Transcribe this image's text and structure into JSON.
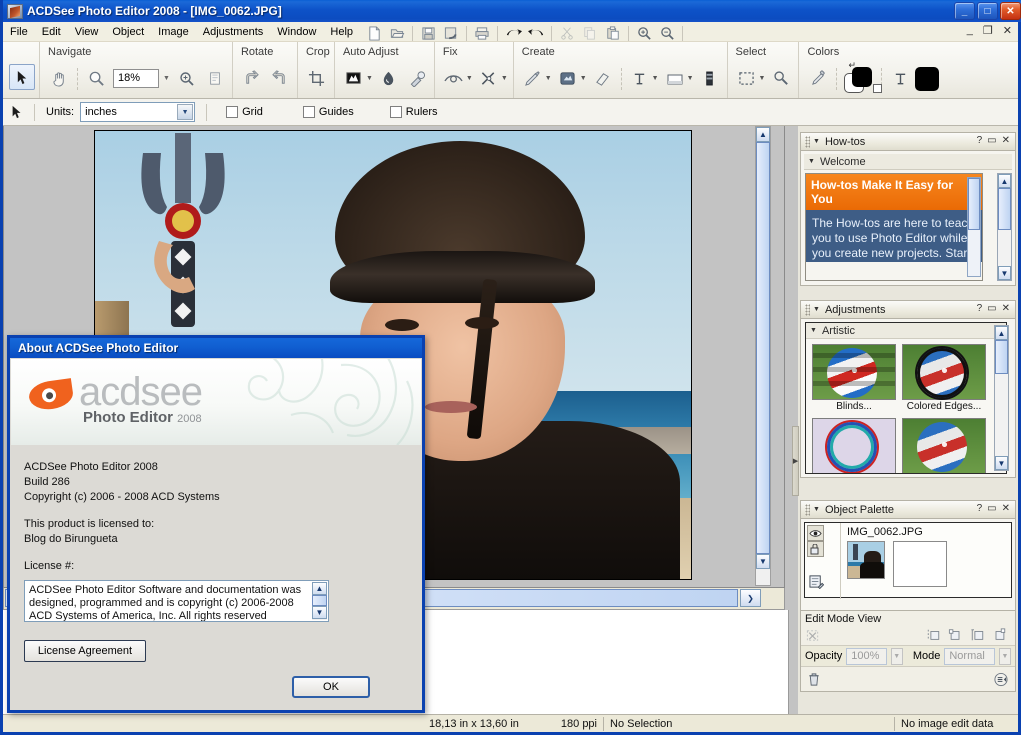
{
  "window": {
    "title": "ACDSee Photo Editor 2008 - [IMG_0062.JPG]",
    "minimize": "_",
    "maximize": "□",
    "close": "✕",
    "mdi_minimize": "_",
    "mdi_restore": "❐",
    "mdi_close": "✕"
  },
  "menu": {
    "items": [
      {
        "label": "File"
      },
      {
        "label": "Edit"
      },
      {
        "label": "View"
      },
      {
        "label": "Object"
      },
      {
        "label": "Image"
      },
      {
        "label": "Adjustments"
      },
      {
        "label": "Window"
      },
      {
        "label": "Help"
      }
    ]
  },
  "standard_toolbar": {
    "icons": [
      "new-icon",
      "open-icon",
      "save-icon",
      "save-as-icon",
      "print-icon",
      "undo-icon",
      "redo-icon",
      "cut-icon",
      "copy-icon",
      "paste-icon",
      "zoom-in-icon",
      "zoom-out-icon"
    ]
  },
  "ribbon": {
    "groups": [
      {
        "title": "Navigate",
        "buttons": [
          "select-tool",
          "pan-tool-icon",
          "zoom-tool-icon",
          "zoom-fit-icon",
          "zoom-actual-icon"
        ]
      },
      {
        "title": "Rotate",
        "buttons": [
          "rotate-right-icon",
          "rotate-left-icon"
        ]
      },
      {
        "title": "Crop",
        "buttons": [
          "crop-icon"
        ]
      },
      {
        "title": "Auto Adjust",
        "buttons": [
          "auto-levels-icon",
          "red-eye-icon",
          "repair-icon"
        ]
      },
      {
        "title": "Fix",
        "buttons": [
          "red-eye-fix-icon",
          "blemish-remover-icon"
        ]
      },
      {
        "title": "Create",
        "buttons": [
          "brush-icon",
          "effects-icon",
          "eraser-icon",
          "text-icon",
          "shape-icon",
          "gradient-icon"
        ]
      },
      {
        "title": "Select",
        "buttons": [
          "marquee-icon",
          "magic-wand-icon"
        ]
      },
      {
        "title": "Colors",
        "buttons": [
          "eyedropper-icon",
          "color-swatches",
          "text-color-icon",
          "fill-color-swatch"
        ]
      }
    ],
    "zoom_value": "18%",
    "zoom_dropdown_icon": "chevron-down-icon"
  },
  "options_bar": {
    "pointer_icon": "arrow-pointer-icon",
    "units_label": "Units:",
    "units_value": "inches",
    "checkboxes": [
      {
        "label": "Grid",
        "checked": false
      },
      {
        "label": "Guides",
        "checked": false
      },
      {
        "label": "Rulers",
        "checked": false
      }
    ]
  },
  "canvas": {
    "zoom": "18%",
    "image_name": "IMG_0062.JPG",
    "scrollbar_right_arrow": "❯",
    "scroll_up_arrow": "▲",
    "scroll_down_arrow": "▼"
  },
  "panels": {
    "howtos": {
      "title": "How-tos",
      "help_btn": "?",
      "maximize_btn": "▭",
      "close_btn": "✕",
      "section": "Welcome",
      "banner": "How-tos Make It Easy for You",
      "body": "The How-tos are here to teach you to use Photo Editor while you create new projects. Start with"
    },
    "adjustments": {
      "title": "Adjustments",
      "help_btn": "?",
      "maximize_btn": "▭",
      "close_btn": "✕",
      "section": "Artistic",
      "items": [
        {
          "label": "Blinds...",
          "thumb": "blinds-thumbnail"
        },
        {
          "label": "Colored Edges...",
          "thumb": "colored-edges-thumbnail"
        },
        {
          "label": "",
          "thumb": "contours-thumbnail"
        },
        {
          "label": "",
          "thumb": "crosshatch-thumbnail"
        }
      ]
    },
    "object_palette": {
      "title": "Object Palette",
      "help_btn": "?",
      "maximize_btn": "▭",
      "close_btn": "✕",
      "layer_name": "IMG_0062.JPG",
      "visibility_icon": "eye-icon",
      "link-icon": "link-layers-icon",
      "properties_icon": "layer-properties-icon",
      "edit_mode_label": "Edit Mode View",
      "opacity_label": "Opacity",
      "opacity_value": "100%",
      "mode_label": "Mode",
      "mode_value": "Normal",
      "delete_icon": "trash-icon",
      "menu_icon": "palette-menu-icon"
    }
  },
  "statusbar": {
    "dimensions": "18,13 in x 13,60 in",
    "resolution": "180 ppi",
    "selection": "No Selection",
    "edit_data": "No image edit data"
  },
  "about_dialog": {
    "title": "About ACDSee Photo Editor",
    "logo_word": "acdsee",
    "logo_sub": "Photo Editor",
    "logo_year": "2008",
    "product": "ACDSee Photo Editor 2008",
    "build": "Build 286",
    "copyright": "Copyright (c) 2006 - 2008 ACD Systems",
    "licensed_to_label": "This product is licensed to:",
    "licensed_to_name": "Blog do Birungueta",
    "license_label": "License #:",
    "license_text_lines": [
      "ACDSee Photo Editor Software and documentation was",
      "designed, programmed and is copyright (c) 2006-2008",
      "ACD Systems of America, Inc. All rights reserved"
    ],
    "license_agreement_button": "License Agreement",
    "ok_button": "OK",
    "scroll_up": "▲",
    "scroll_down": "▼"
  },
  "colors": {
    "titlebar_start": "#0a5fd4",
    "titlebar_end": "#0c4cc0",
    "accent_orange": "#ea6a05",
    "howto_body_bg": "#3e5d86",
    "dialog_bg": "#dcdad5"
  }
}
